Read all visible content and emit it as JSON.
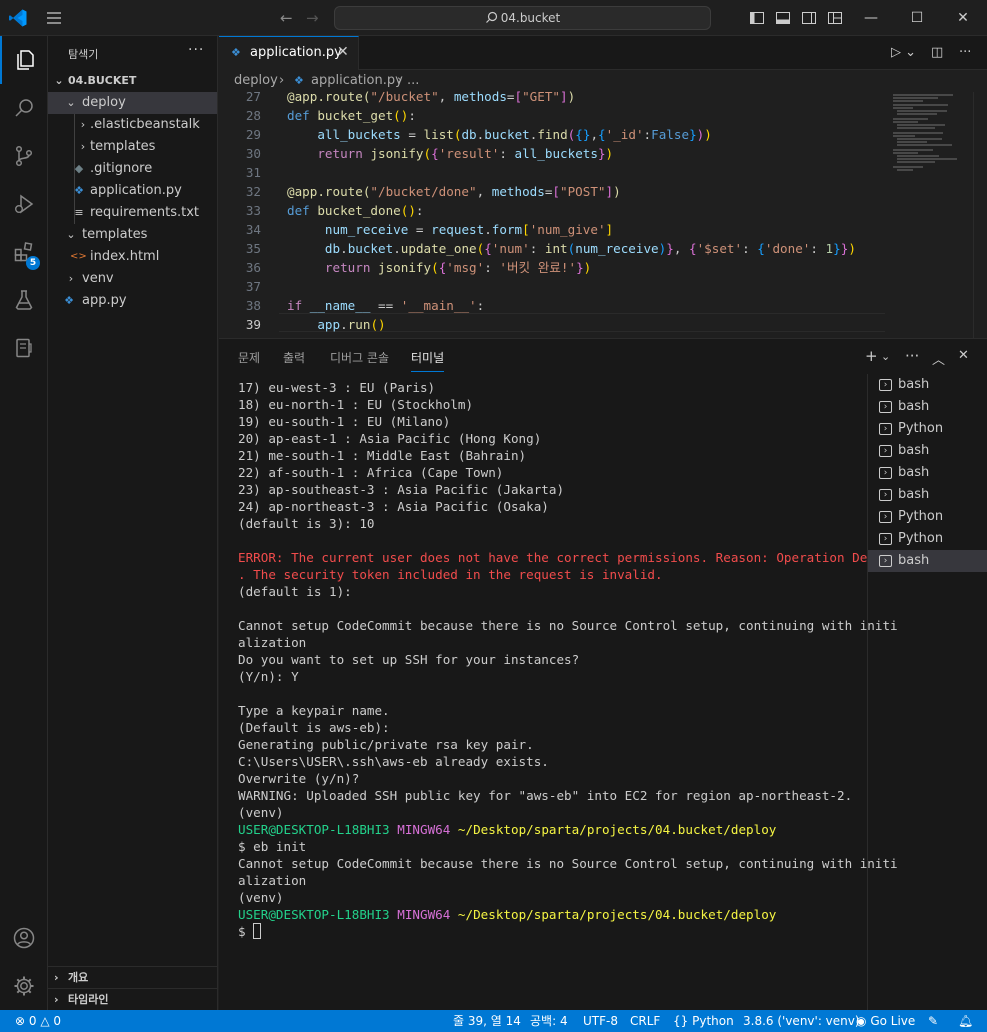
{
  "titlebar": {
    "search_text": "04.bucket"
  },
  "activitybar": {
    "extensions_badge": "5"
  },
  "sidebar": {
    "title": "탐색기",
    "more": "···",
    "root": "04.BUCKET",
    "items": [
      {
        "label": "deploy"
      },
      {
        "label": ".elasticbeanstalk"
      },
      {
        "label": "templates"
      },
      {
        "label": ".gitignore"
      },
      {
        "label": "application.py"
      },
      {
        "label": "requirements.txt"
      },
      {
        "label": "templates"
      },
      {
        "label": "index.html"
      },
      {
        "label": "venv"
      },
      {
        "label": "app.py"
      }
    ],
    "outline": "개요",
    "timeline": "타임라인"
  },
  "editor": {
    "tab_label": "application.py",
    "breadcrumb": {
      "folder": "deploy",
      "file": "application.py",
      "more": "..."
    },
    "line_numbers": [
      "27",
      "28",
      "29",
      "30",
      "31",
      "32",
      "33",
      "34",
      "35",
      "36",
      "37",
      "38",
      "39"
    ]
  },
  "panel": {
    "tabs": [
      "문제",
      "출력",
      "디버그 콘솔",
      "터미널"
    ],
    "terminal_lines": [
      "17) eu-west-3 : EU (Paris)",
      "18) eu-north-1 : EU (Stockholm)",
      "19) eu-south-1 : EU (Milano)",
      "20) ap-east-1 : Asia Pacific (Hong Kong)",
      "21) me-south-1 : Middle East (Bahrain)",
      "22) af-south-1 : Africa (Cape Town)",
      "23) ap-southeast-3 : Asia Pacific (Jakarta)",
      "24) ap-northeast-3 : Asia Pacific (Osaka)",
      "(default is 3): 10",
      "",
      "ERROR: The current user does not have the correct permissions. Reason: Operation Denied",
      ". The security token included in the request is invalid.",
      "(default is 1):",
      "",
      "Cannot setup CodeCommit because there is no Source Control setup, continuing with initi",
      "alization",
      "Do you want to set up SSH for your instances?",
      "(Y/n): Y",
      "",
      "Type a keypair name.",
      "(Default is aws-eb):",
      "Generating public/private rsa key pair.",
      "C:\\Users\\USER\\.ssh\\aws-eb already exists.",
      "Overwrite (y/n)?",
      "WARNING: Uploaded SSH public key for \"aws-eb\" into EC2 for region ap-northeast-2.",
      "(venv)"
    ],
    "prompt": {
      "user": "USER@DESKTOP-L18BHI3",
      "shell": "MINGW64",
      "path": "~/Desktop/sparta/projects/04.bucket/deploy"
    },
    "command": "$ eb init",
    "after_lines": [
      "Cannot setup CodeCommit because there is no Source Control setup, continuing with initi",
      "alization",
      "(venv)"
    ],
    "final_prompt": "$ ",
    "terminals": [
      "bash",
      "bash",
      "Python",
      "bash",
      "bash",
      "bash",
      "Python",
      "Python",
      "bash"
    ]
  },
  "statusbar": {
    "errors": "0",
    "warnings": "0",
    "position": "줄 39, 열 14",
    "spaces": "공백: 4",
    "encoding": "UTF-8",
    "eol": "CRLF",
    "language": "Python",
    "interpreter": "3.8.6 ('venv': venv)",
    "golive": "Go Live"
  }
}
